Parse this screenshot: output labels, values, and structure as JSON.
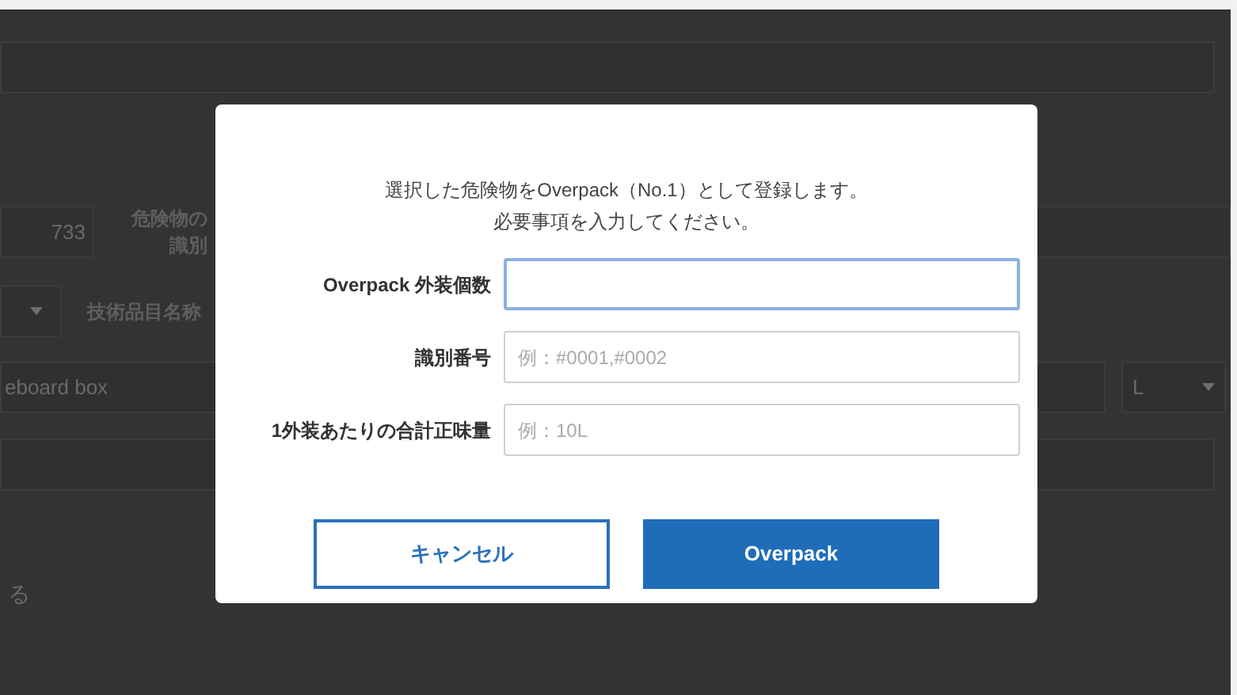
{
  "page": {
    "row_2": {
      "field_value": "733",
      "label_lines": [
        "危険物の",
        "識別"
      ]
    },
    "row_3": {
      "label": "技術品目名称"
    },
    "row_4": {
      "field_value": "eboard box",
      "unit_select": "L"
    },
    "note": "る"
  },
  "dialog": {
    "message_lines": [
      "選択した危険物をOverpack（No.1）として登録します。",
      "必要事項を入力してください。"
    ],
    "fields": [
      {
        "label": "Overpack 外装個数",
        "focused": true
      },
      {
        "label": "識別番号",
        "placeholder": "例：#0001,#0002",
        "focused": false
      },
      {
        "label": "1外装あたりの合計正味量",
        "placeholder": "例：10L",
        "focused": false
      }
    ],
    "buttons": [
      {
        "label": "キャンセル",
        "kind": "secondary"
      },
      {
        "label": "Overpack",
        "kind": "primary"
      }
    ]
  }
}
